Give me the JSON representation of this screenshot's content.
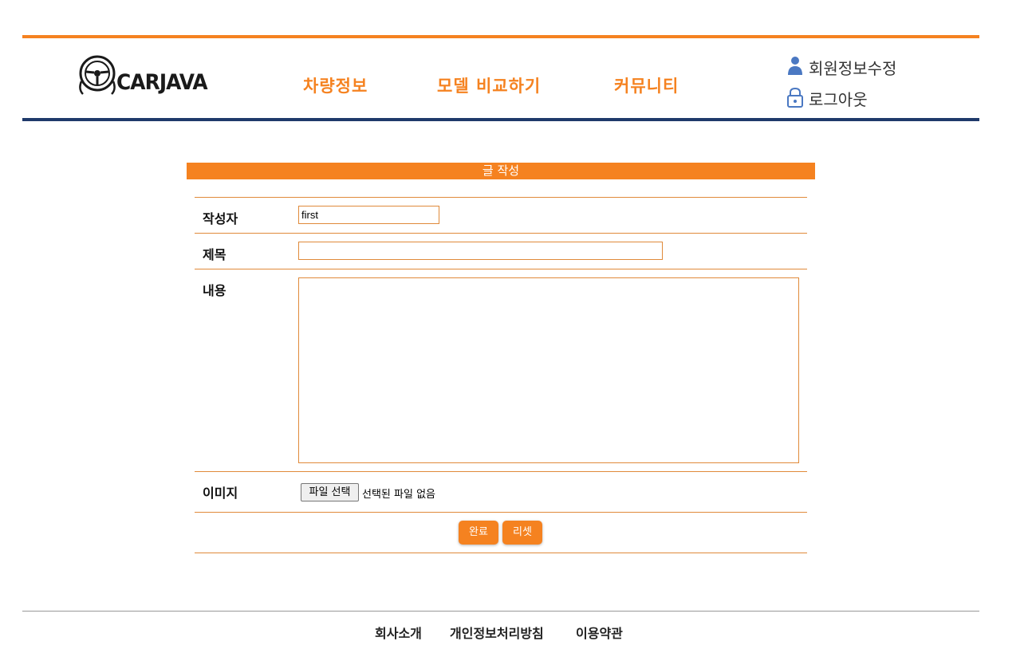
{
  "header": {
    "brand": "CARJAVA",
    "nav": [
      "차량정보",
      "모델 비교하기",
      "커뮤니티"
    ],
    "user_menu": {
      "edit_profile": "회원정보수정",
      "logout": "로그아웃"
    }
  },
  "form": {
    "title": "글 작성",
    "author_label": "작성자",
    "author_value": "first",
    "subject_label": "제목",
    "subject_value": "",
    "content_label": "내용",
    "content_value": "",
    "image_label": "이미지",
    "file_button": "파일 선택",
    "file_status": "선택된 파일 없음",
    "submit_label": "완료",
    "reset_label": "리셋"
  },
  "footer": {
    "links": [
      "회사소개",
      "개인정보처리방침",
      "이용약관"
    ]
  },
  "colors": {
    "accent": "#f58220",
    "navy": "#1f3a6b"
  }
}
